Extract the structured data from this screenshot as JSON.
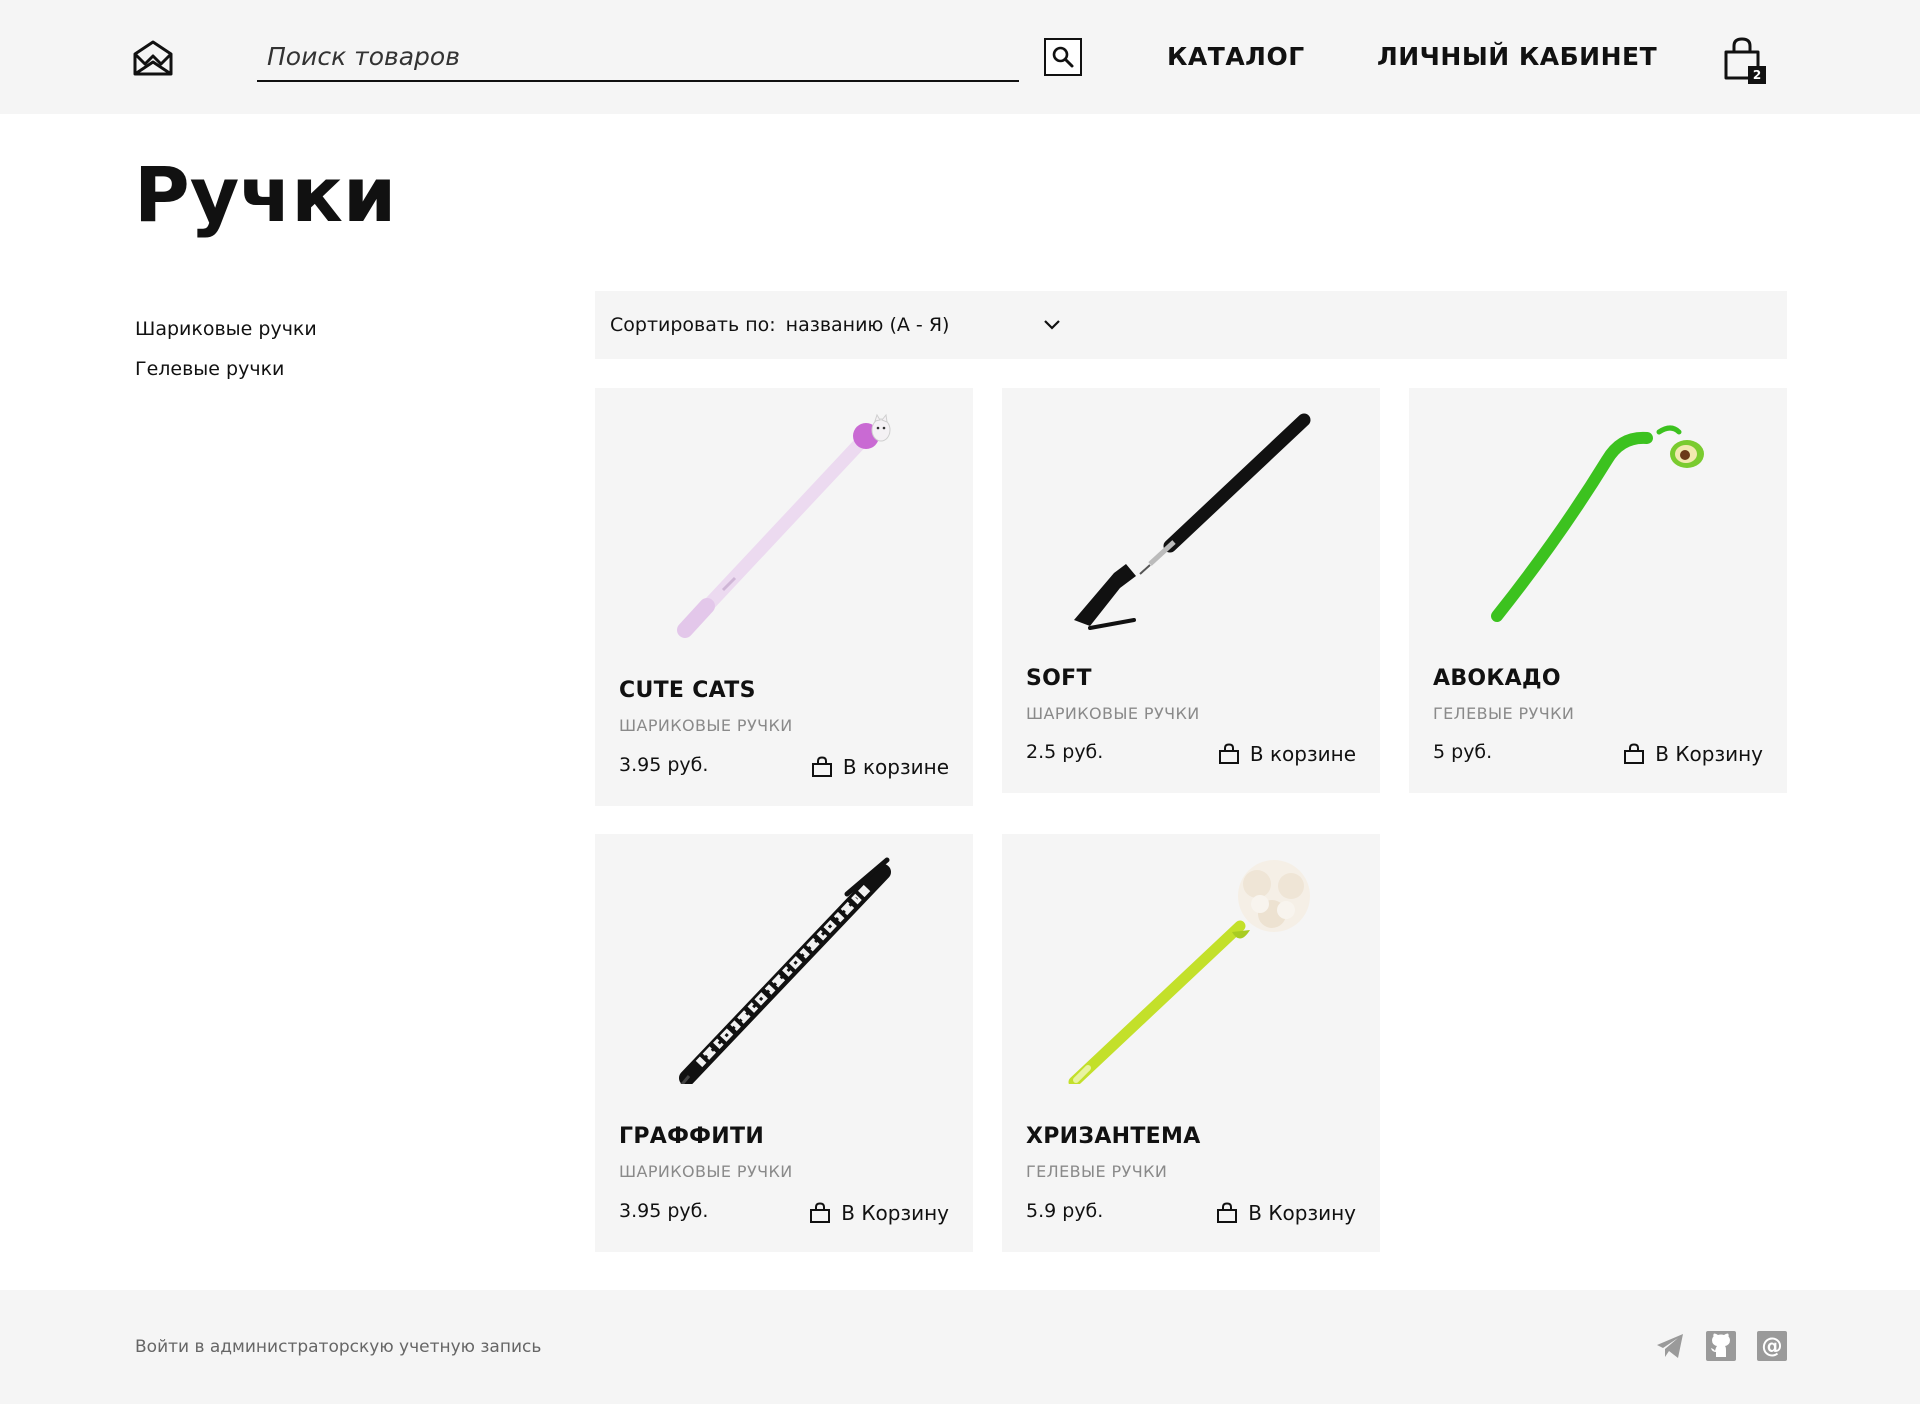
{
  "header": {
    "logo_icon": "crown-envelope-logo-icon",
    "search": {
      "placeholder": "Поиск товаров",
      "value": ""
    },
    "nav": {
      "catalog": "КАТАЛОГ",
      "account": "ЛИЧНЫЙ КАБИНЕТ"
    },
    "cart": {
      "count": "2"
    }
  },
  "page": {
    "title": "Ручки"
  },
  "sidebar": {
    "items": [
      {
        "label": "Шариковые ручки"
      },
      {
        "label": "Гелевые ручки"
      }
    ]
  },
  "sort": {
    "label": "Сортировать по:",
    "value": "названию (А - Я)"
  },
  "products": [
    {
      "name": "CUTE CATS",
      "category": "ШАРИКОВЫЕ РУЧКИ",
      "price": "3.95 руб.",
      "cart_label": "В корзине",
      "image": "pink-cat-pen"
    },
    {
      "name": "SOFT",
      "category": "ШАРИКОВЫЕ РУЧКИ",
      "price": "2.5 руб.",
      "cart_label": "В корзине",
      "image": "black-pen"
    },
    {
      "name": "АВОКАДО",
      "category": "ГЕЛЕВЫЕ РУЧКИ",
      "price": "5 руб.",
      "cart_label": "В Корзину",
      "image": "green-avocado-pen"
    },
    {
      "name": "ГРАФФИТИ",
      "category": "ШАРИКОВЫЕ РУЧКИ",
      "price": "3.95 руб.",
      "cart_label": "В Корзину",
      "image": "graffiti-pen"
    },
    {
      "name": "ХРИЗАНТЕМА",
      "category": "ГЕЛЕВЫЕ РУЧКИ",
      "price": "5.9 руб.",
      "cart_label": "В Корзину",
      "image": "flower-pen"
    }
  ],
  "footer": {
    "admin_link": "Войти в администраторскую учетную запись",
    "social": [
      "telegram-icon",
      "github-icon",
      "email-at-icon"
    ]
  },
  "colors": {
    "panel_bg": "#f5f5f5",
    "text": "#111111",
    "muted": "#8a8a8a"
  }
}
